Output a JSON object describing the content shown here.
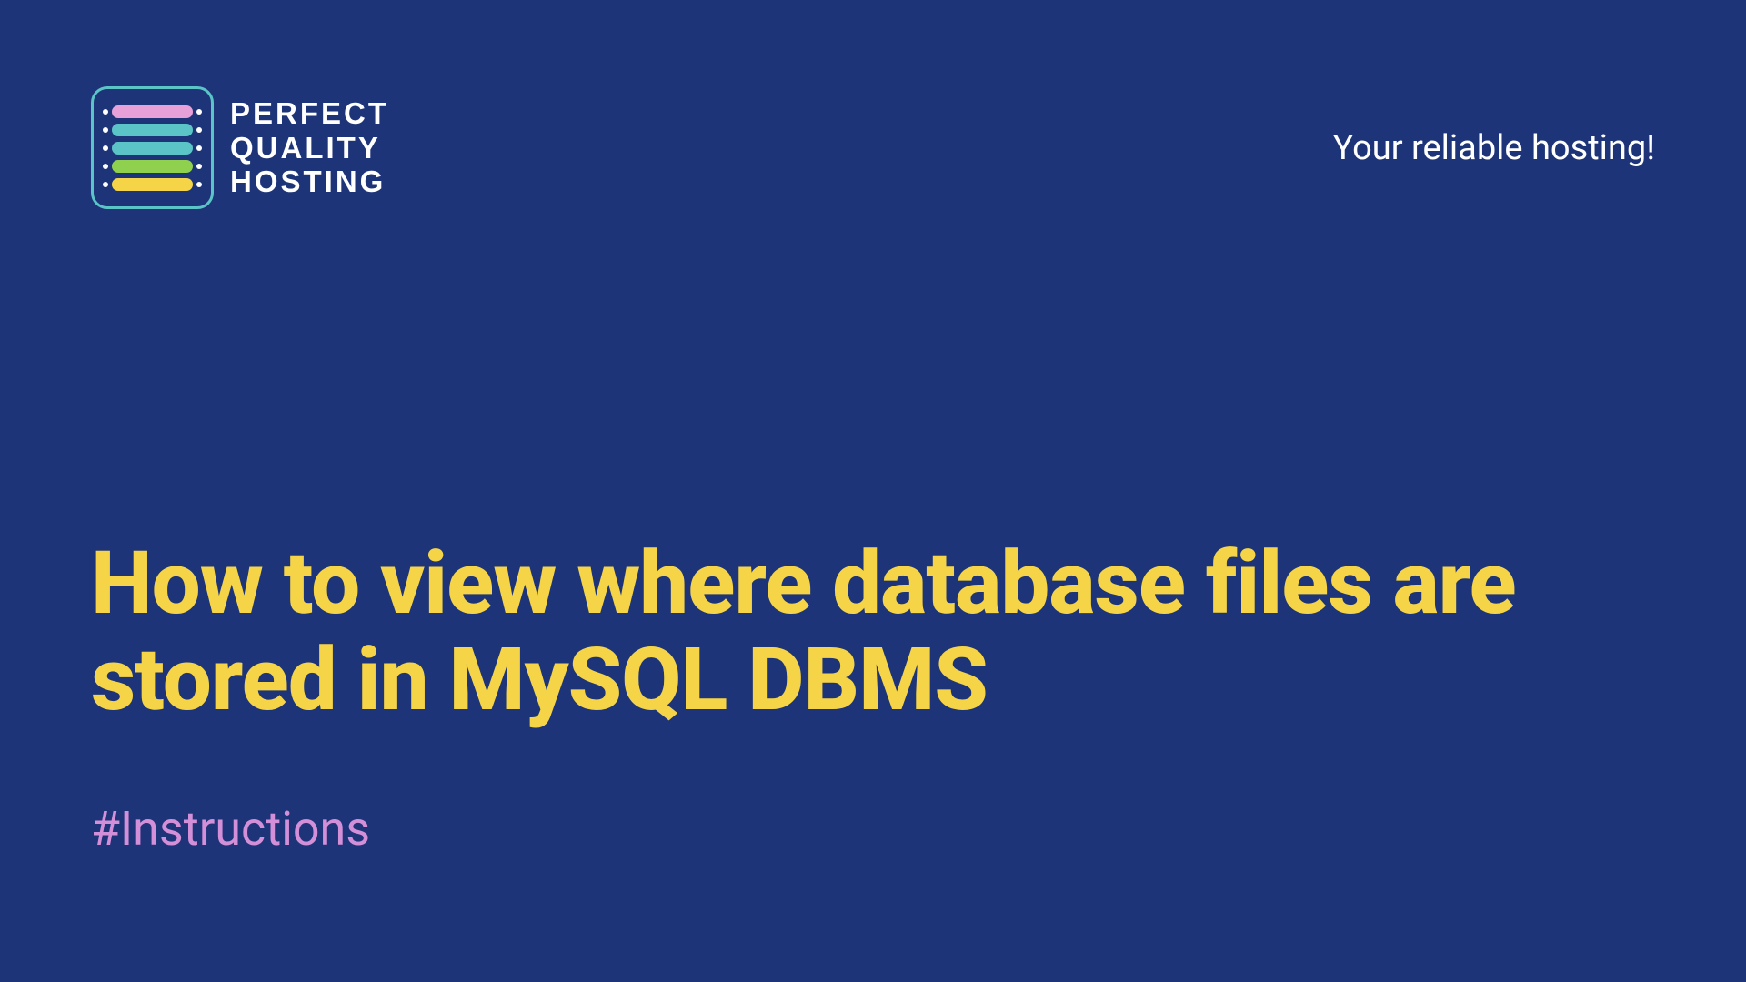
{
  "logo": {
    "line1": "PERFECT",
    "line2": "QUALITY",
    "line3": "HOSTING"
  },
  "tagline": "Your reliable hosting!",
  "title": "How to view where database files are stored in MySQL DBMS",
  "hashtag": "#Instructions"
}
